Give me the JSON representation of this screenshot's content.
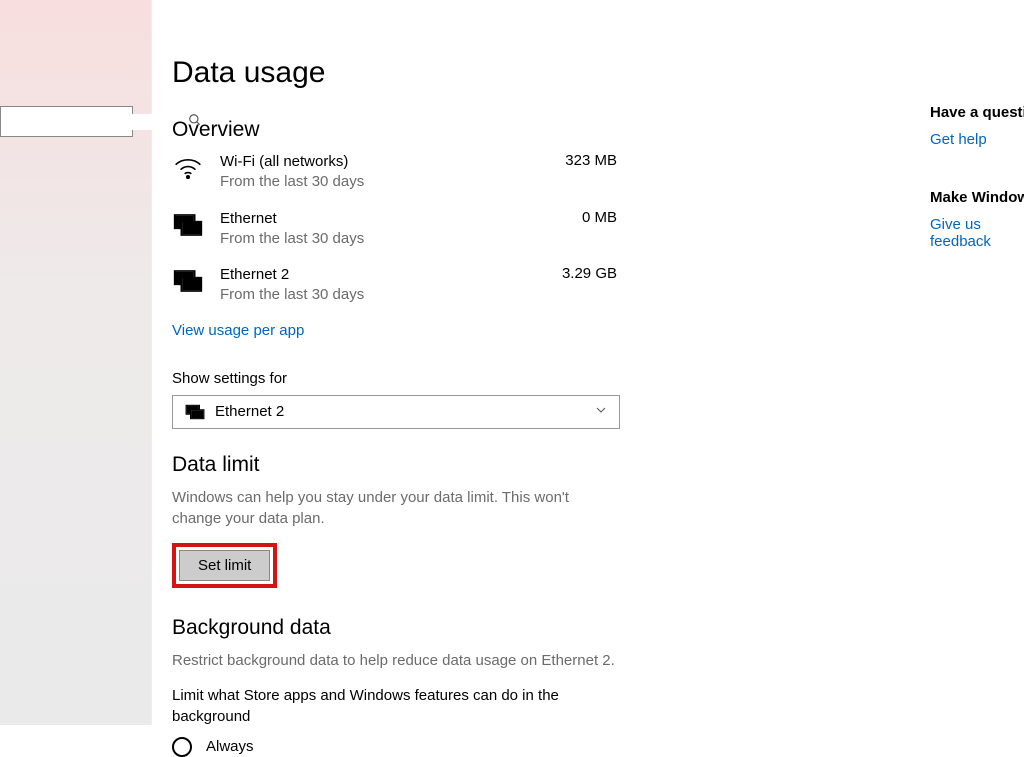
{
  "page": {
    "title": "Data usage"
  },
  "overview": {
    "heading": "Overview",
    "items": [
      {
        "name": "Wi-Fi (all networks)",
        "sub": "From the last 30 days",
        "value": "323 MB",
        "icon": "wifi"
      },
      {
        "name": "Ethernet",
        "sub": "From the last 30 days",
        "value": "0 MB",
        "icon": "ethernet"
      },
      {
        "name": "Ethernet 2",
        "sub": "From the last 30 days",
        "value": "3.29 GB",
        "icon": "ethernet"
      }
    ],
    "view_link": "View usage per app"
  },
  "show_settings": {
    "label": "Show settings for",
    "selected": "Ethernet 2"
  },
  "data_limit": {
    "heading": "Data limit",
    "desc": "Windows can help you stay under your data limit. This won't change your data plan.",
    "button": "Set limit"
  },
  "background_data": {
    "heading": "Background data",
    "desc": "Restrict background data to help reduce data usage on Ethernet 2.",
    "sublabel": "Limit what Store apps and Windows features can do in the background",
    "option": "Always"
  },
  "rightcol": {
    "q_head": "Have a question?",
    "q_link": "Get help",
    "w_head": "Make Windows better",
    "w_link": "Give us feedback"
  },
  "search": {
    "placeholder": ""
  }
}
